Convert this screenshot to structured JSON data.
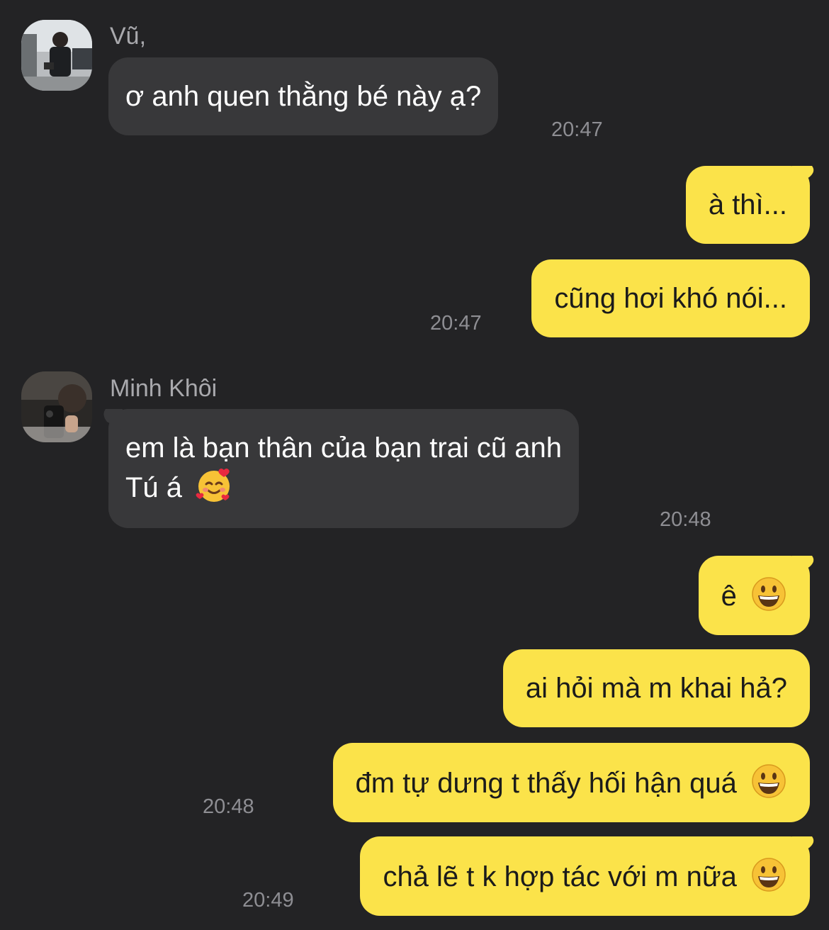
{
  "messages": {
    "m1": {
      "sender": "Vũ,",
      "text": "ơ anh quen thằng bé này ạ?",
      "time": "20:47"
    },
    "m2": {
      "text": "à thì..."
    },
    "m3": {
      "text": "cũng hơi khó nói...",
      "time": "20:47"
    },
    "m4": {
      "sender": "Minh Khôi",
      "line1": "em là bạn thân của bạn trai cũ anh",
      "line2": "Tú á",
      "emoji": "🥰",
      "time": "20:48"
    },
    "m5": {
      "text": "ê",
      "emoji": "😀"
    },
    "m6": {
      "text": "ai hỏi mà m khai hả?"
    },
    "m7": {
      "text": "đm tự dưng t thấy hối hận quá",
      "emoji": "😀",
      "time": "20:48"
    },
    "m8": {
      "text": "chả lẽ t k hợp tác với m nữa",
      "emoji": "😀",
      "time": "20:49"
    }
  },
  "colors": {
    "background": "#232325",
    "incoming_bubble": "#38383a",
    "outgoing_bubble": "#fbe34a",
    "timestamp": "#8e8e93"
  }
}
